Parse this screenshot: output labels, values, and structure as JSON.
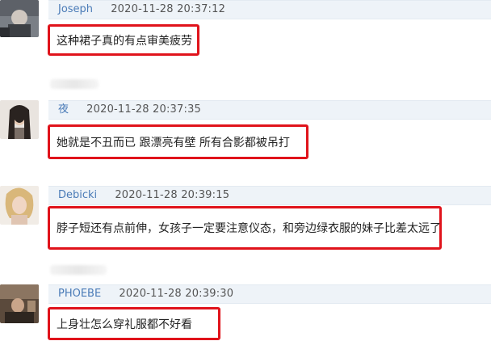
{
  "comments": [
    {
      "username": "Joseph",
      "time": "2020-11-28 20:37:12",
      "text": "这种裙子真的有点审美疲劳",
      "avatar_icon": "user-avatar"
    },
    {
      "username": "夜",
      "time": "2020-11-28 20:37:35",
      "text": "她就是不丑而已 跟漂亮有壁 所有合影都被吊打",
      "avatar_icon": "user-avatar"
    },
    {
      "username": "Debicki",
      "time": "2020-11-28 20:39:15",
      "text": "脖子短还有点前伸，女孩子一定要注意仪态，和旁边绿衣服的妹子比差太远了",
      "avatar_icon": "user-avatar"
    },
    {
      "username": "PHOEBE",
      "time": "2020-11-28 20:39:30",
      "text": "上身壮怎么穿礼服都不好看",
      "avatar_icon": "user-avatar"
    }
  ],
  "colors": {
    "highlight_border": "#e0131b",
    "username": "#4a7bb7",
    "header_bg": "#eef3f8"
  }
}
